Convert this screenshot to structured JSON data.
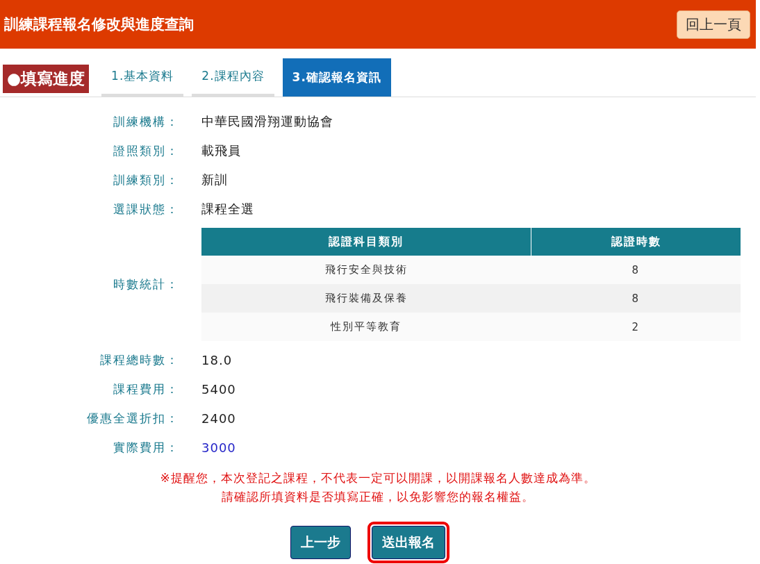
{
  "header": {
    "title": "訓練課程報名修改與進度查詢",
    "back_button": "回上一頁"
  },
  "progress": {
    "label": "●填寫進度",
    "tabs": [
      {
        "label": "1.基本資料",
        "selected": false
      },
      {
        "label": "2.課程內容",
        "selected": false
      },
      {
        "label": "3.確認報名資訊",
        "selected": true
      }
    ]
  },
  "fields_top": [
    {
      "label": "訓練機構：",
      "value": "中華民國滑翔運動協會"
    },
    {
      "label": "證照類別：",
      "value": "載飛員"
    },
    {
      "label": "訓練類別：",
      "value": "新訓"
    },
    {
      "label": "選課狀態：",
      "value": "課程全選"
    }
  ],
  "hours": {
    "label": "時數統計：",
    "columns": [
      "認證科目類別",
      "認證時數"
    ],
    "rows": [
      [
        "飛行安全與技術",
        "8"
      ],
      [
        "飛行裝備及保養",
        "8"
      ],
      [
        "性別平等教育",
        "2"
      ]
    ]
  },
  "fields_bottom": [
    {
      "label": "課程總時數：",
      "value": "18.0",
      "kind": "plain"
    },
    {
      "label": "課程費用：",
      "value": "5400",
      "kind": "plain"
    },
    {
      "label": "優惠全選折扣：",
      "value": "2400",
      "kind": "plain"
    },
    {
      "label": "實際費用：",
      "value": "3000",
      "kind": "total"
    }
  ],
  "notice": [
    "※提醒您，本次登記之課程，不代表一定可以開課，以開課報名人數達成為準。",
    "請確認所填資料是否填寫正確，以免影響您的報名權益。"
  ],
  "buttons": [
    {
      "label": "上一步",
      "highlighted": false
    },
    {
      "label": "送出報名",
      "highlighted": true
    }
  ]
}
